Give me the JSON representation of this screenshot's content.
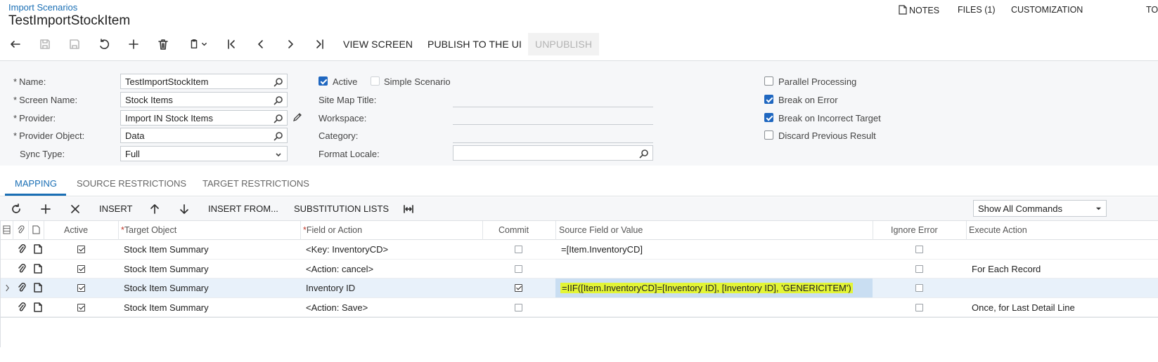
{
  "header": {
    "breadcrumb": "Import Scenarios",
    "title": "TestImportStockItem",
    "nav": {
      "notes": "NOTES",
      "files": "FILES (1)",
      "customization": "CUSTOMIZATION",
      "tools_partial": "TO"
    }
  },
  "toolbar": {
    "view_screen": "VIEW SCREEN",
    "publish": "PUBLISH TO THE UI",
    "unpublish": "UNPUBLISH"
  },
  "form": {
    "name": {
      "label": "Name:",
      "value": "TestImportStockItem"
    },
    "screen_name": {
      "label": "Screen Name:",
      "value": "Stock Items"
    },
    "provider": {
      "label": "Provider:",
      "value": "Import IN Stock Items"
    },
    "provider_object": {
      "label": "Provider Object:",
      "value": "Data"
    },
    "sync_type": {
      "label": "Sync Type:",
      "value": "Full"
    },
    "active": {
      "label": "Active",
      "checked": true
    },
    "simple_scenario": {
      "label": "Simple Scenario",
      "checked": false
    },
    "site_map_title": {
      "label": "Site Map Title:",
      "value": ""
    },
    "workspace": {
      "label": "Workspace:",
      "value": ""
    },
    "category": {
      "label": "Category:",
      "value": ""
    },
    "format_locale": {
      "label": "Format Locale:",
      "value": ""
    },
    "parallel_processing": {
      "label": "Parallel Processing",
      "checked": false
    },
    "break_on_error": {
      "label": "Break on Error",
      "checked": true
    },
    "break_on_incorrect_target": {
      "label": "Break on Incorrect Target",
      "checked": true
    },
    "discard_previous_result": {
      "label": "Discard Previous Result",
      "checked": false
    }
  },
  "tabs": [
    {
      "label": "MAPPING",
      "active": true
    },
    {
      "label": "SOURCE RESTRICTIONS",
      "active": false
    },
    {
      "label": "TARGET RESTRICTIONS",
      "active": false
    }
  ],
  "grid_toolbar": {
    "insert": "INSERT",
    "insert_from": "INSERT FROM...",
    "substitution_lists": "SUBSTITUTION LISTS",
    "commands_filter": "Show All Commands"
  },
  "grid": {
    "columns": {
      "active": "Active",
      "target_object": "Target Object",
      "field_or_action": "Field or Action",
      "commit": "Commit",
      "source_field_or_value": "Source Field or Value",
      "ignore_error": "Ignore Error",
      "execute_action": "Execute Action"
    },
    "rows": [
      {
        "active": true,
        "target_object": "Stock Item Summary",
        "field_or_action": "<Key: InventoryCD>",
        "commit": false,
        "source": "=[Item.InventoryCD]",
        "ignore_error": false,
        "execute_action": ""
      },
      {
        "active": true,
        "target_object": "Stock Item Summary",
        "field_or_action": "<Action: cancel>",
        "commit": false,
        "source": "",
        "ignore_error": false,
        "execute_action": "For Each Record"
      },
      {
        "active": true,
        "target_object": "Stock Item Summary",
        "field_or_action": "Inventory ID",
        "commit": true,
        "source": "=IIF([Item.InventoryCD]=[Inventory ID], [Inventory ID], 'GENERICITEM')",
        "ignore_error": false,
        "execute_action": ""
      },
      {
        "active": true,
        "target_object": "Stock Item Summary",
        "field_or_action": "<Action: Save>",
        "commit": false,
        "source": "",
        "ignore_error": false,
        "execute_action": "Once, for Last Detail Line"
      }
    ]
  }
}
